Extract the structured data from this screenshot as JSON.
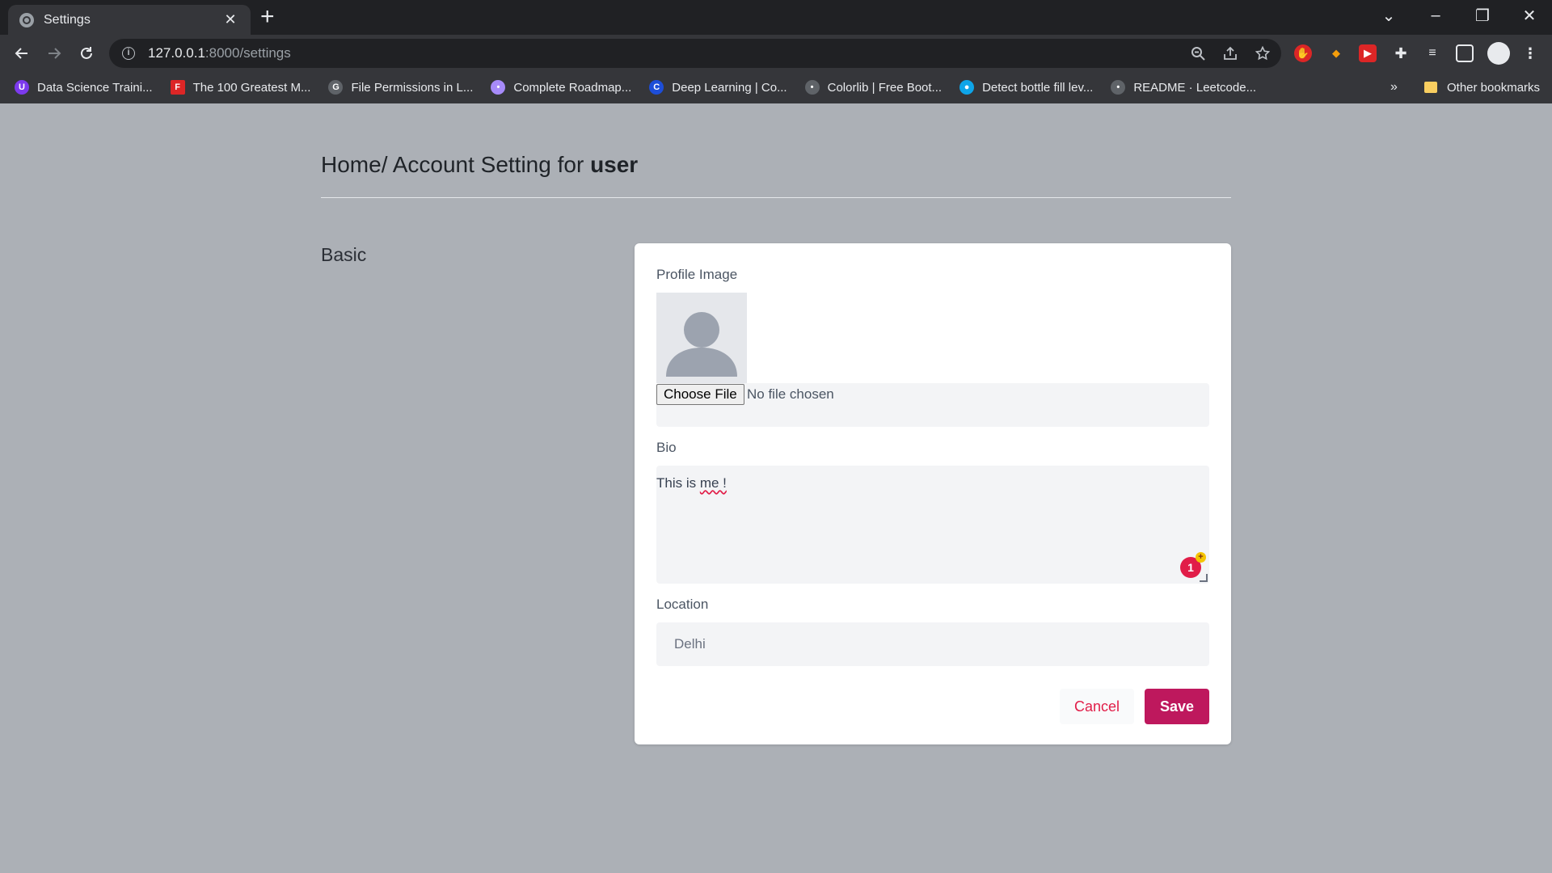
{
  "browser": {
    "tab_title": "Settings",
    "tab_close": "✕",
    "new_tab": "+",
    "url_host": "127.0.0.1",
    "url_path": ":8000/settings",
    "window_controls": [
      "⌄",
      "–",
      "❐",
      "✕"
    ],
    "bookmarks": [
      {
        "label": "Data Science Traini...",
        "icon": "data-science-icon",
        "color": "#7c3aed",
        "glyph": "U"
      },
      {
        "label": "The 100 Greatest M...",
        "icon": "letter-f-icon",
        "color": "#dc2626",
        "glyph": "F"
      },
      {
        "label": "File Permissions in L...",
        "icon": "globe-icon",
        "color": "#5f6368",
        "glyph": "G"
      },
      {
        "label": "Complete Roadmap...",
        "icon": "roadmap-icon",
        "color": "#a78bfa",
        "glyph": "•"
      },
      {
        "label": "Deep Learning | Co...",
        "icon": "letter-c-icon",
        "color": "#1d4ed8",
        "glyph": "C"
      },
      {
        "label": "Colorlib | Free Boot...",
        "icon": "globe-icon",
        "color": "#5f6368",
        "glyph": "•"
      },
      {
        "label": "Detect bottle fill lev...",
        "icon": "eye-icon",
        "color": "#0ea5e9",
        "glyph": "●"
      },
      {
        "label": "README · Leetcode...",
        "icon": "globe-icon",
        "color": "#5f6368",
        "glyph": "•"
      }
    ],
    "bookmarks_more": "»",
    "other_bookmarks": "Other bookmarks"
  },
  "page": {
    "breadcrumb_prefix": "Home/ Account Setting for ",
    "username": "user",
    "section_title": "Basic"
  },
  "form": {
    "profile_image_label": "Profile Image",
    "choose_file_label": "Choose File",
    "no_file_text": "No file chosen",
    "bio_label": "Bio",
    "bio_prefix": "This is ",
    "bio_misspelled": "me !",
    "bio_badge_count": "1",
    "location_label": "Location",
    "location_value": "Delhi",
    "cancel_label": "Cancel",
    "save_label": "Save"
  },
  "colors": {
    "page_background": "#acb0b6",
    "save_button": "#be185d",
    "cancel_text": "#e11d48"
  }
}
